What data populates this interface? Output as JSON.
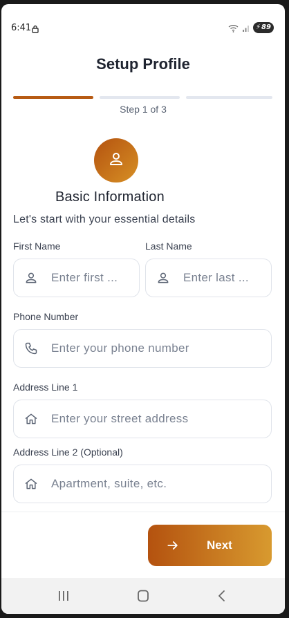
{
  "status_bar": {
    "time": "6:41",
    "battery_level": "89"
  },
  "header": {
    "title": "Setup Profile"
  },
  "progress": {
    "current_step": 1,
    "total_steps": 3,
    "step_text": "Step 1 of 3",
    "active_color": "#b75b14",
    "inactive_color": "#e3e7ef"
  },
  "section": {
    "icon": "person-icon",
    "title": "Basic Information",
    "subtitle": "Let's start with your essential details"
  },
  "form": {
    "first_name": {
      "label": "First Name",
      "placeholder": "Enter first ...",
      "value": ""
    },
    "last_name": {
      "label": "Last Name",
      "placeholder": "Enter last ...",
      "value": ""
    },
    "phone": {
      "label": "Phone Number",
      "placeholder": "Enter your phone number",
      "value": ""
    },
    "address1": {
      "label": "Address Line 1",
      "placeholder": "Enter your street address",
      "value": ""
    },
    "address2": {
      "label": "Address Line 2 (Optional)",
      "placeholder": "Apartment, suite, etc.",
      "value": ""
    }
  },
  "footer": {
    "next_label": "Next"
  },
  "colors": {
    "accent_start": "#b4520f",
    "accent_end": "#d89a2f"
  }
}
